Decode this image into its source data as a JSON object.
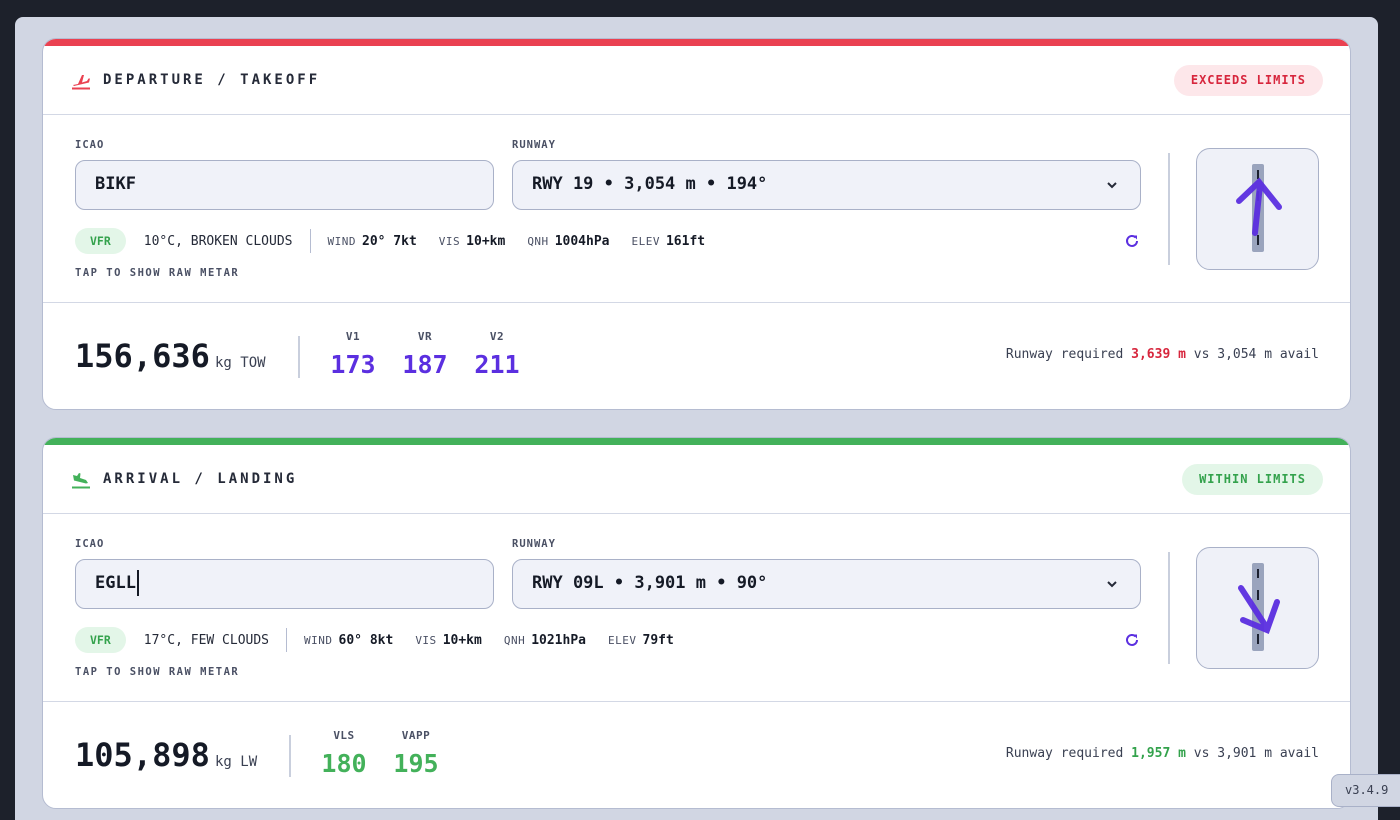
{
  "departure": {
    "title": "DEPARTURE / TAKEOFF",
    "status": "EXCEEDS LIMITS",
    "icao_label": "ICAO",
    "icao_value": "BIKF",
    "runway_label": "RUNWAY",
    "runway_value": "RWY 19 • 3,054 m • 194°",
    "flight_rules": "VFR",
    "conditions": "10°C, BROKEN CLOUDS",
    "wind_label": "WIND",
    "wind_value": "20° 7kt",
    "vis_label": "VIS",
    "vis_value": "10+km",
    "qnh_label": "QNH",
    "qnh_value": "1004hPa",
    "elev_label": "ELEV",
    "elev_value": "161ft",
    "raw_metar": "TAP TO SHOW RAW METAR",
    "weight": "156,636",
    "weight_unit": "kg TOW",
    "speeds": [
      {
        "label": "V1",
        "value": "173"
      },
      {
        "label": "VR",
        "value": "187"
      },
      {
        "label": "V2",
        "value": "211"
      }
    ],
    "req_prefix": "Runway required",
    "req_value": "3,639 m",
    "req_suffix": "vs 3,054 m avail"
  },
  "arrival": {
    "title": "ARRIVAL / LANDING",
    "status": "WITHIN LIMITS",
    "icao_label": "ICAO",
    "icao_value": "EGLL",
    "runway_label": "RUNWAY",
    "runway_value": "RWY 09L • 3,901 m • 90°",
    "flight_rules": "VFR",
    "conditions": "17°C, FEW CLOUDS",
    "wind_label": "WIND",
    "wind_value": "60° 8kt",
    "vis_label": "VIS",
    "vis_value": "10+km",
    "qnh_label": "QNH",
    "qnh_value": "1021hPa",
    "elev_label": "ELEV",
    "elev_value": "79ft",
    "raw_metar": "TAP TO SHOW RAW METAR",
    "weight": "105,898",
    "weight_unit": "kg LW",
    "speeds": [
      {
        "label": "VLS",
        "value": "180"
      },
      {
        "label": "VAPP",
        "value": "195"
      }
    ],
    "req_prefix": "Runway required",
    "req_value": "1,957 m",
    "req_suffix": "vs 3,901 m avail"
  },
  "version": "v3.4.9",
  "colors": {
    "exceeds": "#ea4151",
    "within": "#43b15a",
    "accent": "#5b2fe0"
  },
  "icons": [
    "plane-takeoff-icon",
    "plane-landing-icon",
    "chevron-down-icon",
    "refresh-icon",
    "wind-arrow-icon"
  ]
}
